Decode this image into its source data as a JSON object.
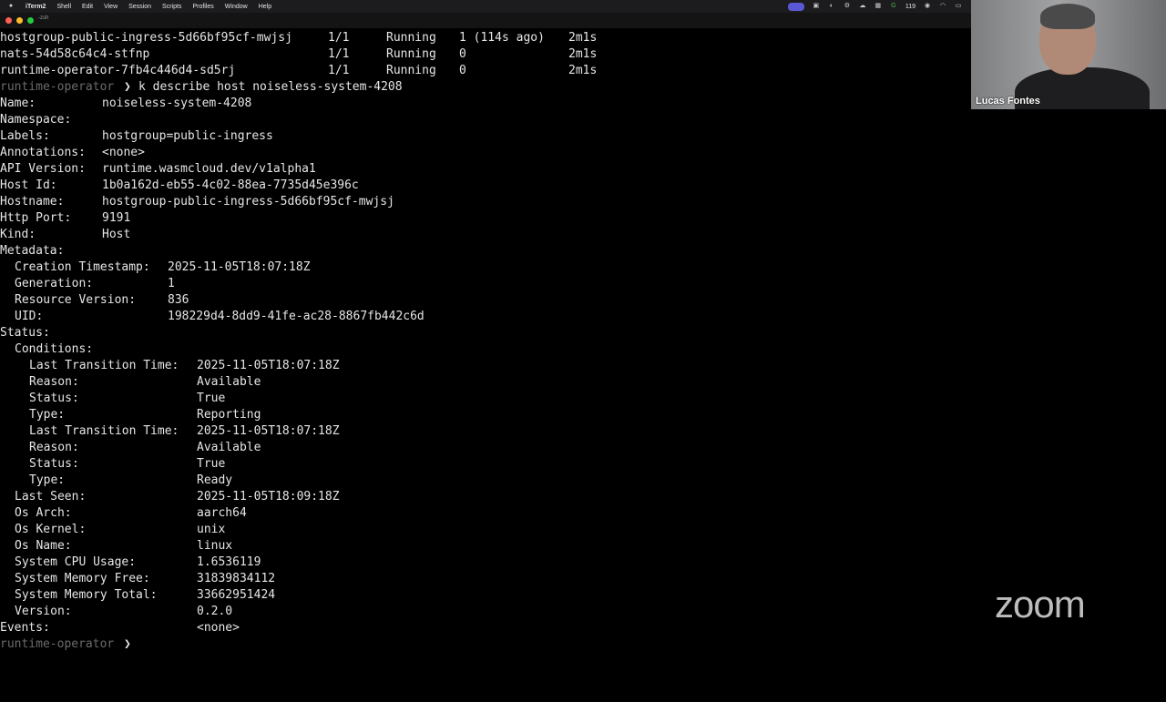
{
  "menubar": {
    "apple_icon": "apple-icon",
    "app": "iTerm2",
    "items": [
      "Shell",
      "Edit",
      "View",
      "Session",
      "Scripts",
      "Profiles",
      "Window",
      "Help"
    ],
    "status_text": "119"
  },
  "tab": {
    "title": "-zsh"
  },
  "terminal": {
    "pods": [
      {
        "name": "hostgroup-public-ingress-5d66bf95cf-mwjsj",
        "ready": "1/1",
        "status": "Running",
        "restarts": "1 (114s ago)",
        "age": "2m1s"
      },
      {
        "name": "nats-54d58c64c4-stfnp",
        "ready": "1/1",
        "status": "Running",
        "restarts": "0",
        "age": "2m1s"
      },
      {
        "name": "runtime-operator-7fb4c446d4-sd5rj",
        "ready": "1/1",
        "status": "Running",
        "restarts": "0",
        "age": "2m1s"
      }
    ],
    "prompt_dir": "runtime-operator",
    "prompt_symbol": "❯",
    "command": "k describe host noiseless-system-4208",
    "describe": [
      {
        "key": "Name:",
        "value": "noiseless-system-4208"
      },
      {
        "key": "Namespace:",
        "value": ""
      },
      {
        "key": "Labels:",
        "value": "hostgroup=public-ingress"
      },
      {
        "key": "Annotations:",
        "value": "<none>"
      },
      {
        "key": "API Version:",
        "value": "runtime.wasmcloud.dev/v1alpha1"
      },
      {
        "key": "Host Id:",
        "value": "1b0a162d-eb55-4c02-88ea-7735d45e396c"
      },
      {
        "key": "Hostname:",
        "value": "hostgroup-public-ingress-5d66bf95cf-mwjsj"
      },
      {
        "key": "Http Port:",
        "value": "9191"
      },
      {
        "key": "Kind:",
        "value": "Host"
      },
      {
        "key": "Metadata:",
        "value": ""
      },
      {
        "key": "Creation Timestamp:",
        "value": "2025-11-05T18:07:18Z"
      },
      {
        "key": "Generation:",
        "value": "1"
      },
      {
        "key": "Resource Version:",
        "value": "836"
      },
      {
        "key": "UID:",
        "value": "198229d4-8dd9-41fe-ac28-8867fb442c6d"
      },
      {
        "key": "Status:",
        "value": ""
      },
      {
        "key": "Conditions:",
        "value": ""
      },
      {
        "key": "Last Transition Time:",
        "value": "2025-11-05T18:07:18Z"
      },
      {
        "key": "Reason:",
        "value": "Available"
      },
      {
        "key": "Status:",
        "value": "True"
      },
      {
        "key": "Type:",
        "value": "Reporting"
      },
      {
        "key": "Last Transition Time:",
        "value": "2025-11-05T18:07:18Z"
      },
      {
        "key": "Reason:",
        "value": "Available"
      },
      {
        "key": "Status:",
        "value": "True"
      },
      {
        "key": "Type:",
        "value": "Ready"
      },
      {
        "key": "Last Seen:",
        "value": "2025-11-05T18:09:18Z"
      },
      {
        "key": "Os Arch:",
        "value": "aarch64"
      },
      {
        "key": "Os Kernel:",
        "value": "unix"
      },
      {
        "key": "Os Name:",
        "value": "linux"
      },
      {
        "key": "System CPU Usage:",
        "value": "1.6536119"
      },
      {
        "key": "System Memory Free:",
        "value": "31839834112"
      },
      {
        "key": "System Memory Total:",
        "value": "33662951424"
      },
      {
        "key": "Version:",
        "value": "0.2.0"
      },
      {
        "key": "Events:",
        "value": "<none>"
      }
    ]
  },
  "video": {
    "participant_name": "Lucas Fontes"
  },
  "zoom_logo": "zoom",
  "colors": {
    "background": "#000000",
    "text": "#e6e6e6",
    "prompt": "#6b6b6b",
    "zoom_logo": "#bdbdbd"
  }
}
